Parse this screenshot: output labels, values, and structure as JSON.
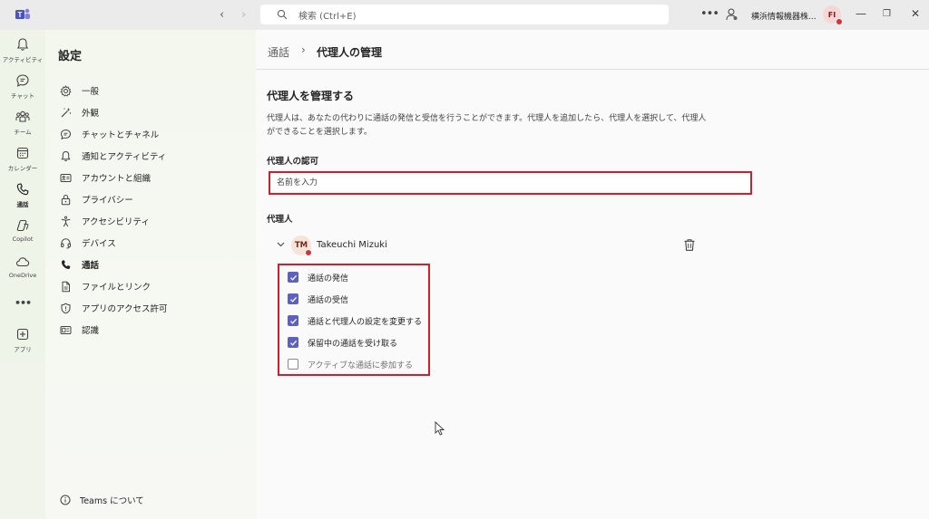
{
  "topbar": {
    "search_placeholder": "検索 (Ctrl+E)",
    "org_name": "横浜情報機器株...",
    "user_initials": "FI",
    "more_label": "•••"
  },
  "rail": {
    "items": [
      {
        "label": "アクティビティ",
        "icon": "bell-icon"
      },
      {
        "label": "チャット",
        "icon": "chat-icon"
      },
      {
        "label": "チーム",
        "icon": "teams-icon"
      },
      {
        "label": "カレンダー",
        "icon": "calendar-icon"
      },
      {
        "label": "通話",
        "icon": "phone-icon"
      },
      {
        "label": "Copilot",
        "icon": "copilot-icon"
      },
      {
        "label": "OneDrive",
        "icon": "onedrive-icon"
      },
      {
        "label": "•••",
        "icon": "more-icon"
      },
      {
        "label": "アプリ",
        "icon": "add-apps-icon"
      }
    ]
  },
  "settings": {
    "title": "設定",
    "menu": [
      {
        "label": "一般",
        "icon": "gear-icon"
      },
      {
        "label": "外観",
        "icon": "wand-icon"
      },
      {
        "label": "チャットとチャネル",
        "icon": "chat-icon"
      },
      {
        "label": "通知とアクティビティ",
        "icon": "bell-icon"
      },
      {
        "label": "アカウントと組織",
        "icon": "id-card-icon"
      },
      {
        "label": "プライバシー",
        "icon": "lock-icon"
      },
      {
        "label": "アクセシビリティ",
        "icon": "accessibility-icon"
      },
      {
        "label": "デバイス",
        "icon": "headset-icon"
      },
      {
        "label": "通話",
        "icon": "phone-icon"
      },
      {
        "label": "ファイルとリンク",
        "icon": "file-icon"
      },
      {
        "label": "アプリのアクセス許可",
        "icon": "shield-icon"
      },
      {
        "label": "認識",
        "icon": "recognition-icon"
      }
    ],
    "about_label": "Teams について"
  },
  "main": {
    "breadcrumb_root": "通話",
    "breadcrumb_sep": "›",
    "breadcrumb_current": "代理人の管理",
    "section_title": "代理人を管理する",
    "description": "代理人は、あなたの代わりに通話の発信と受信を行うことができます。代理人を追加したら、代理人を選択して、代理人ができることを選択します。",
    "grant_label": "代理人の認可",
    "name_placeholder": "名前を入力",
    "delegates_label": "代理人",
    "delegate": {
      "initials": "TM",
      "name": "Takeuchi Mizuki"
    },
    "permissions": [
      {
        "label": "通話の発信",
        "checked": true
      },
      {
        "label": "通話の受信",
        "checked": true
      },
      {
        "label": "通話と代理人の設定を変更する",
        "checked": true
      },
      {
        "label": "保留中の通話を受け取る",
        "checked": true
      },
      {
        "label": "アクティブな通話に参加する",
        "checked": false
      }
    ]
  },
  "colors": {
    "accent": "#5b5fc7",
    "highlight_border": "#d0202e",
    "presence_busy": "#d13438"
  }
}
